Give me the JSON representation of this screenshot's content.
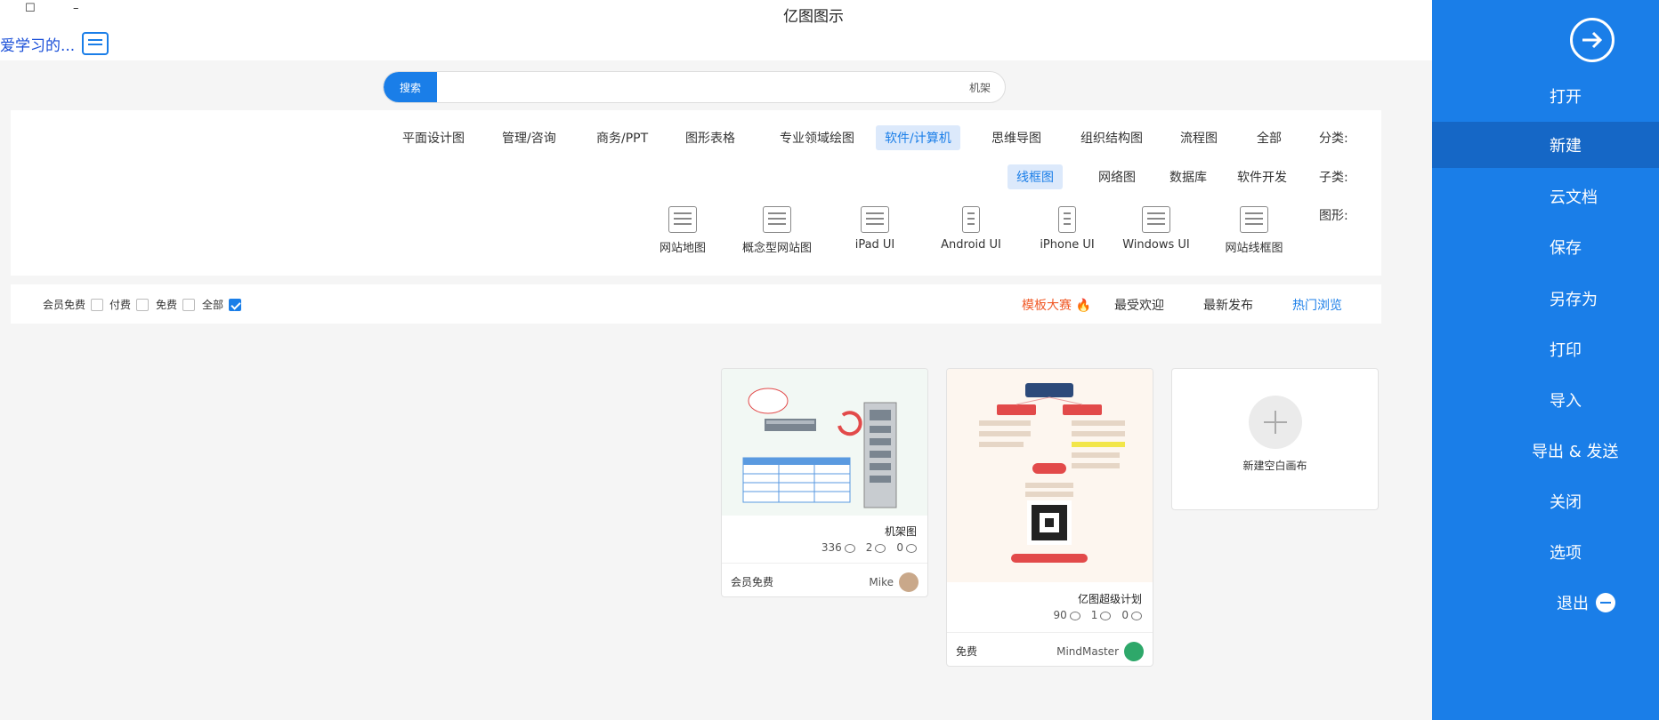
{
  "window": {
    "title": "亿图图示",
    "minimize": "–",
    "maximize": "☐"
  },
  "user": {
    "name": "爱学习的..."
  },
  "sidebar": {
    "items": [
      {
        "label": "打开"
      },
      {
        "label": "新建"
      },
      {
        "label": "云文档"
      },
      {
        "label": "保存"
      },
      {
        "label": "另存为"
      },
      {
        "label": "打印"
      },
      {
        "label": "导入"
      },
      {
        "label": "导出 & 发送"
      },
      {
        "label": "关闭"
      },
      {
        "label": "选项"
      },
      {
        "label": "退出"
      }
    ],
    "active": "新建",
    "color": "#1a7ee8"
  },
  "search": {
    "button": "搜索",
    "value": "机架"
  },
  "categories": {
    "label": "分类:",
    "items": [
      "全部",
      "流程图",
      "组织结构图",
      "思维导图",
      "软件/计算机",
      "专业领域绘图",
      "图形表格",
      "商务/PPT",
      "管理/咨询",
      "平面设计图"
    ],
    "active": "软件/计算机"
  },
  "subcategories": {
    "label": "子类:",
    "items": [
      "软件开发",
      "数据库",
      "网络图",
      "线框图"
    ],
    "active": "线框图"
  },
  "shapes": {
    "label": "图形:",
    "items": [
      "网站线框图",
      "Windows UI",
      "iPhone UI",
      "Android UI",
      "iPad UI",
      "概念型网站图",
      "网站地图"
    ]
  },
  "filters": {
    "tabs": [
      "热门浏览",
      "最新发布",
      "最受欢迎",
      "模板大赛"
    ],
    "active": "热门浏览",
    "hot": "模板大赛",
    "checks": [
      {
        "label": "全部",
        "checked": true
      },
      {
        "label": "免费",
        "checked": false
      },
      {
        "label": "付费",
        "checked": false
      },
      {
        "label": "会员免费",
        "checked": false
      }
    ]
  },
  "new_card": {
    "label": "新建空白画布"
  },
  "templates": [
    {
      "title": "亿图超级计划",
      "views": "90",
      "likes": "1",
      "favorites": "0",
      "author": "MindMaster",
      "price": "免费"
    },
    {
      "title": "机架图",
      "views": "336",
      "likes": "2",
      "favorites": "0",
      "author": "Mike",
      "price": "会员免费"
    }
  ]
}
